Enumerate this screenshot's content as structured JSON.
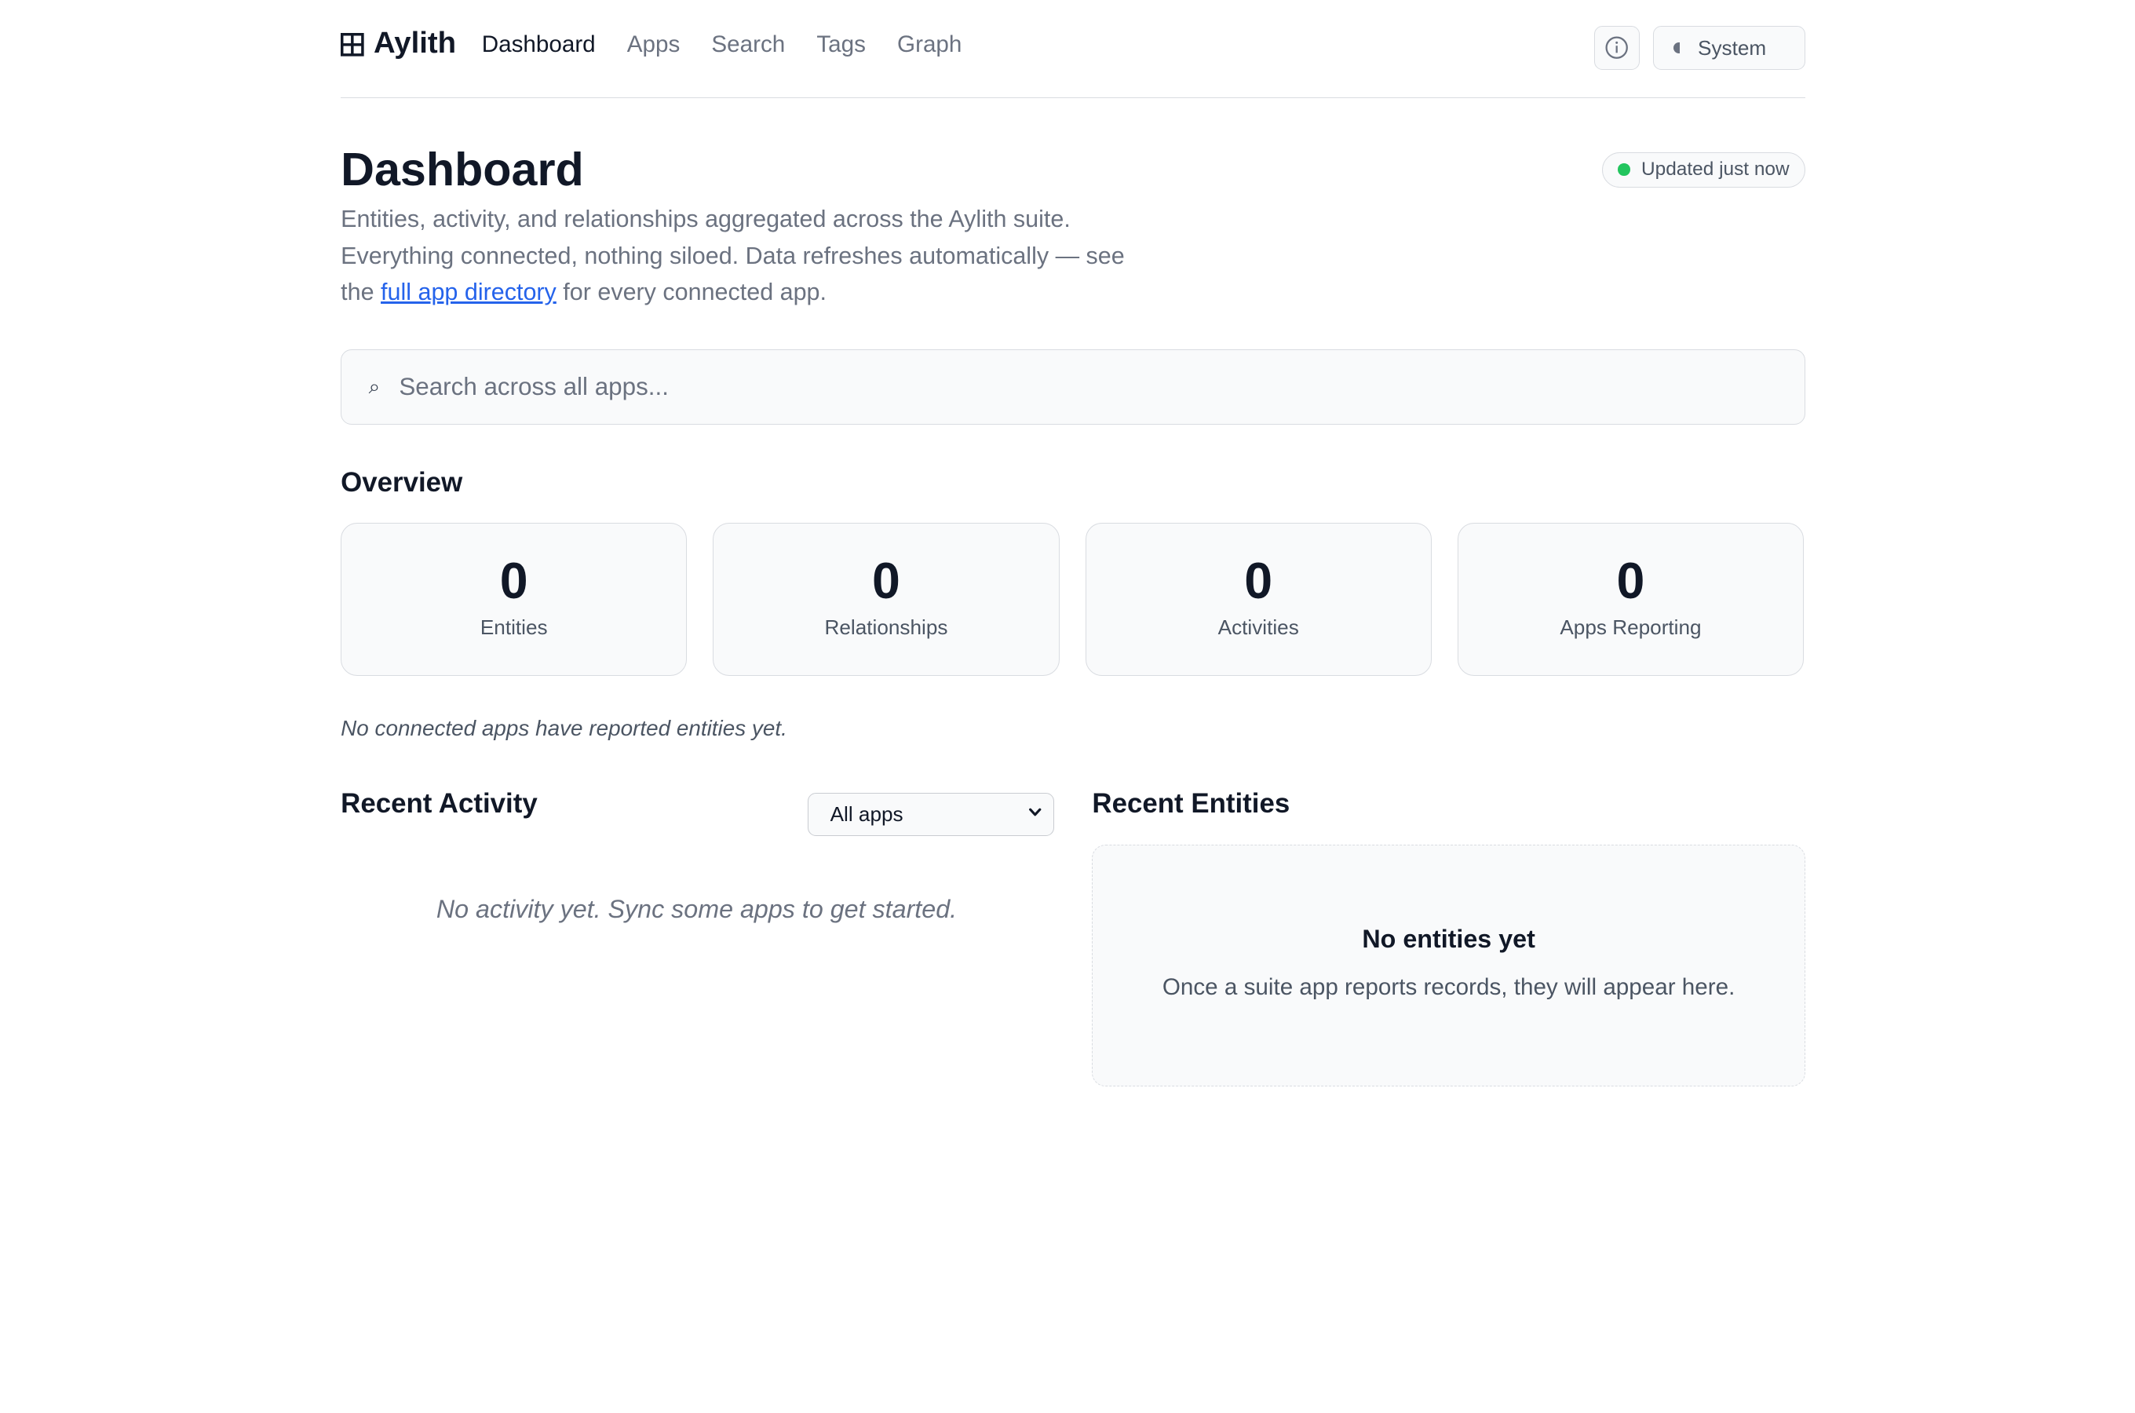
{
  "header": {
    "brand": "Aylith",
    "nav": [
      "Dashboard",
      "Apps",
      "Search",
      "Tags",
      "Graph"
    ],
    "active_nav": "Dashboard",
    "theme_label": "System"
  },
  "page": {
    "title": "Dashboard",
    "description_part1": "Entities, activity, and relationships aggregated across the Aylith suite. Everything connected, nothing siloed. Data refreshes automatically — see the ",
    "description_link": "full app directory",
    "description_part2": " for every connected app.",
    "status": "Updated just now"
  },
  "search": {
    "placeholder": "Search across all apps..."
  },
  "overview": {
    "heading": "Overview",
    "stats": [
      {
        "value": "0",
        "label": "Entities"
      },
      {
        "value": "0",
        "label": "Relationships"
      },
      {
        "value": "0",
        "label": "Activities"
      },
      {
        "value": "0",
        "label": "Apps Reporting"
      }
    ],
    "note": "No connected apps have reported entities yet."
  },
  "recent_activity": {
    "heading": "Recent Activity",
    "filter_value": "All apps",
    "empty": "No activity yet. Sync some apps to get started."
  },
  "recent_entities": {
    "heading": "Recent Entities",
    "empty_title": "No entities yet",
    "empty_text": "Once a suite app reports records, they will appear here."
  },
  "colors": {
    "accent_link": "#2563eb",
    "status_ok": "#22c55e",
    "text_primary": "#111827",
    "text_muted": "#6b7280",
    "border": "#d9dce1",
    "card_bg": "#f9fafb"
  }
}
